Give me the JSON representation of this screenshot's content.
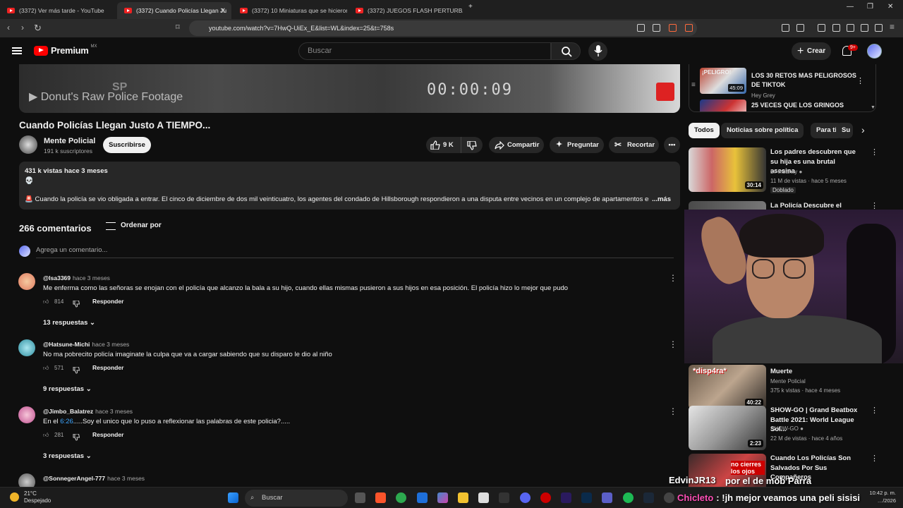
{
  "browser": {
    "tabs": [
      {
        "label": "(3372) Ver más tarde - YouTube"
      },
      {
        "label": "(3372) Cuando Policías Llegan Ju"
      },
      {
        "label": "(3372) 10 Miniaturas que se hicieron"
      },
      {
        "label": "(3372) JUEGOS FLASH PERTURBADOR"
      }
    ],
    "url": "youtube.com/watch?v=7HwQ-UiEx_E&list=WL&index=25&t=758s"
  },
  "header": {
    "logo": "Premium",
    "region": "MX",
    "search_placeholder": "Buscar",
    "create": "Crear",
    "notifications": "9+"
  },
  "player": {
    "source_text": "Donut's Raw Police Footage",
    "timecode": "00:00:09",
    "sp": "SP"
  },
  "video": {
    "title": "Cuando Policías Llegan Justo A TIEMPO...",
    "channel": "Mente Policial",
    "subscribers": "191 k suscriptores",
    "subscribe": "Suscribirse",
    "likes": "9 K",
    "share": "Compartir",
    "ask": "Preguntar",
    "clip": "Recortar"
  },
  "description": {
    "meta": "431 k vistas  hace 3 meses",
    "skull": "💀",
    "text": "🚨 Cuando la policía se vio obligada a entrar. El cinco de diciembre de dos mil veinticuatro, los agentes del condado de Hillsborough respondieron a una disputa entre vecinos en un complejo de apartamentos en la c",
    "more": "...más"
  },
  "comments": {
    "count": "266 comentarios",
    "sort": "Ordenar por",
    "add_placeholder": "Agrega un comentario...",
    "items": [
      {
        "author": "@Isa3369",
        "when": "hace 3 meses",
        "text": "Me enferma como las señoras se enojan con el policía que alcanzo la bala a su hijo, cuando ellas mismas pusieron a sus hijos en esa posición. El policía hizo lo mejor que pudo",
        "likes": "814",
        "reply": "Responder",
        "replies": "13 respuestas"
      },
      {
        "author": "@Hatsune-Michi",
        "when": "hace 3 meses",
        "text": "No ma pobrecito policía imaginate la culpa que va a cargar sabiendo que su disparo le dio al niño",
        "likes": "571",
        "reply": "Responder",
        "replies": "9 respuestas"
      },
      {
        "author": "@Jimbo_Balatrez",
        "when": "hace 3 meses",
        "text_pre": "En el ",
        "timestamp": "6:26",
        "text_post": ".....Soy el unico que lo puso a reflexionar las palabras de este policia?.....",
        "likes": "281",
        "reply": "Responder",
        "replies": "3 respuestas"
      },
      {
        "author": "@SonnegerAngel-777",
        "when": "hace 3 meses"
      }
    ]
  },
  "playlist": [
    {
      "title": "LOS 30 RETOS MAS PELIGROSOS DE TIKTOK",
      "channel": "Hey Grey",
      "duration": "45:09",
      "thumb_text": "¡PELIGRO!"
    },
    {
      "title": "25 VECES QUE LOS GRINGOS"
    }
  ],
  "chips": [
    "Todos",
    "Noticias sobre política",
    "Para ti",
    "Su"
  ],
  "recommendations": [
    {
      "title": "Los padres descubren que su hija es una brutal asesina",
      "channel": "Dr Insanity",
      "meta": "11 M de vistas · hace 5 meses",
      "duration": "30:14",
      "badge": "Doblado"
    },
    {
      "title": "La Policía Descubre el Bosque"
    },
    {
      "title": "Muerte",
      "channel": "Mente Policial",
      "meta": "375 k vistas · hace 4 meses",
      "duration": "40:22",
      "thumb_text": "*disp4ra*"
    },
    {
      "title": "SHOW-GO | Grand Beatbox Battle 2021: World League Sol...",
      "channel": "SHOW-GO",
      "meta": "22 M de vistas · hace 4 años",
      "duration": "2:23"
    },
    {
      "title": "Cuando Los Policías Son Salvados Por Sus Compañeros",
      "thumb_text": "no cierres los ojos"
    }
  ],
  "stream_overlay": {
    "name": "EdvinJR13",
    "name_text": "por el de mob Parra",
    "chat_user": "Chicleto",
    "chat_text": ": !jh mejor veamos una peli sisisi"
  },
  "taskbar": {
    "temp": "21°C",
    "weather": "Despejado",
    "search": "Buscar",
    "time": "10:42 p. m.",
    "date": "…/2026"
  },
  "colors": {
    "accent_red": "#ff0000",
    "link_blue": "#3ea6ff",
    "chat_user": "#ff4fb6"
  }
}
